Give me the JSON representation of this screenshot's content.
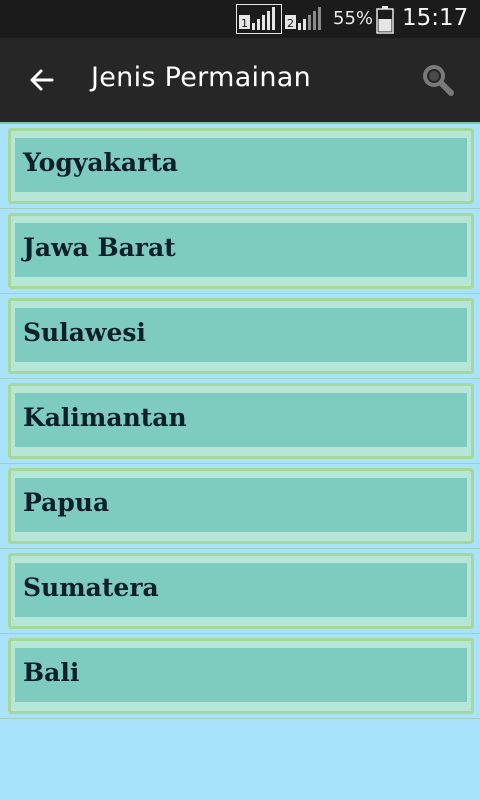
{
  "status_bar": {
    "sim1_label": "1",
    "sim2_label": "2",
    "battery_percent": "55%",
    "time": "15:17"
  },
  "app_bar": {
    "title": "Jenis Permainan",
    "back_icon": "arrow-left-icon",
    "search_icon": "search-icon"
  },
  "regions": [
    {
      "label": "Yogyakarta"
    },
    {
      "label": "Jawa Barat"
    },
    {
      "label": "Sulawesi"
    },
    {
      "label": "Kalimantan"
    },
    {
      "label": "Papua"
    },
    {
      "label": "Sumatera"
    },
    {
      "label": "Bali"
    }
  ],
  "colors": {
    "background": "#a9e2fb",
    "app_bar": "#262626",
    "item_fill": "#7ecbbf",
    "item_border": "#a6d89a",
    "label_text": "#0d1f2b"
  }
}
